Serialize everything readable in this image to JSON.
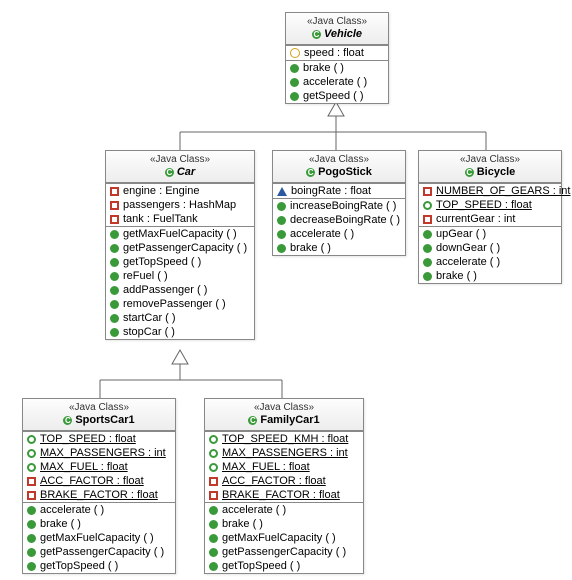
{
  "stereotype": "«Java Class»",
  "classes": {
    "vehicle": {
      "name": "Vehicle",
      "italic": true,
      "attrs": [
        {
          "marker": "diamond",
          "text": "speed : float"
        }
      ],
      "ops": [
        {
          "marker": "green-dot",
          "text": "brake ( )"
        },
        {
          "marker": "green-dot",
          "text": "accelerate ( )"
        },
        {
          "marker": "green-dot",
          "text": "getSpeed ( )"
        }
      ]
    },
    "car": {
      "name": "Car",
      "italic": true,
      "attrs": [
        {
          "marker": "red-sq",
          "text": "engine : Engine"
        },
        {
          "marker": "red-sq",
          "text": "passengers : HashMap"
        },
        {
          "marker": "red-sq",
          "text": "tank : FuelTank"
        }
      ],
      "ops": [
        {
          "marker": "green-dot",
          "text": "getMaxFuelCapacity ( )"
        },
        {
          "marker": "green-dot",
          "text": "getPassengerCapacity ( )"
        },
        {
          "marker": "green-dot",
          "text": "getTopSpeed ( )"
        },
        {
          "marker": "green-dot",
          "text": "reFuel ( )"
        },
        {
          "marker": "green-dot",
          "text": "addPassenger ( )"
        },
        {
          "marker": "green-dot",
          "text": "removePassenger ( )"
        },
        {
          "marker": "green-dot",
          "text": "startCar ( )"
        },
        {
          "marker": "green-dot",
          "text": "stopCar ( )"
        }
      ]
    },
    "pogo": {
      "name": "PogoStick",
      "italic": false,
      "attrs": [
        {
          "marker": "blue-tri",
          "text": "boingRate : float"
        }
      ],
      "ops": [
        {
          "marker": "green-dot",
          "text": "increaseBoingRate ( )"
        },
        {
          "marker": "green-dot",
          "text": "decreaseBoingRate ( )"
        },
        {
          "marker": "green-dot",
          "text": "accelerate ( )"
        },
        {
          "marker": "green-dot",
          "text": "brake ( )"
        }
      ]
    },
    "bicycle": {
      "name": "Bicycle",
      "italic": false,
      "attrs": [
        {
          "marker": "red-sq",
          "text": "NUMBER_OF_GEARS : int",
          "underline": true
        },
        {
          "marker": "green-ring",
          "text": "TOP_SPEED : float",
          "underline": true
        },
        {
          "marker": "red-sq",
          "text": "currentGear : int"
        }
      ],
      "ops": [
        {
          "marker": "green-dot",
          "text": "upGear ( )"
        },
        {
          "marker": "green-dot",
          "text": "downGear ( )"
        },
        {
          "marker": "green-dot",
          "text": "accelerate ( )"
        },
        {
          "marker": "green-dot",
          "text": "brake ( )"
        }
      ]
    },
    "sports": {
      "name": "SportsCar1",
      "italic": false,
      "attrs": [
        {
          "marker": "green-ring",
          "text": "TOP_SPEED : float",
          "underline": true
        },
        {
          "marker": "green-ring",
          "text": "MAX_PASSENGERS : int",
          "underline": true
        },
        {
          "marker": "green-ring",
          "text": "MAX_FUEL : float",
          "underline": true
        },
        {
          "marker": "red-sq",
          "text": "ACC_FACTOR : float",
          "underline": true
        },
        {
          "marker": "red-sq",
          "text": "BRAKE_FACTOR : float",
          "underline": true
        }
      ],
      "ops": [
        {
          "marker": "green-dot",
          "text": "accelerate ( )"
        },
        {
          "marker": "green-dot",
          "text": "brake ( )"
        },
        {
          "marker": "green-dot",
          "text": "getMaxFuelCapacity ( )"
        },
        {
          "marker": "green-dot",
          "text": "getPassengerCapacity ( )"
        },
        {
          "marker": "green-dot",
          "text": "getTopSpeed ( )"
        }
      ]
    },
    "family": {
      "name": "FamilyCar1",
      "italic": false,
      "attrs": [
        {
          "marker": "green-ring",
          "text": "TOP_SPEED_KMH : float",
          "underline": true
        },
        {
          "marker": "green-ring",
          "text": "MAX_PASSENGERS : int",
          "underline": true
        },
        {
          "marker": "green-ring",
          "text": "MAX_FUEL : float",
          "underline": true
        },
        {
          "marker": "red-sq",
          "text": "ACC_FACTOR : float",
          "underline": true
        },
        {
          "marker": "red-sq",
          "text": "BRAKE_FACTOR : float",
          "underline": true
        }
      ],
      "ops": [
        {
          "marker": "green-dot",
          "text": "accelerate ( )"
        },
        {
          "marker": "green-dot",
          "text": "brake ( )"
        },
        {
          "marker": "green-dot",
          "text": "getMaxFuelCapacity ( )"
        },
        {
          "marker": "green-dot",
          "text": "getPassengerCapacity ( )"
        },
        {
          "marker": "green-dot",
          "text": "getTopSpeed ( )"
        }
      ]
    }
  },
  "chart_data": {
    "type": "table",
    "description": "UML class inheritance diagram",
    "inheritance": [
      {
        "child": "Car",
        "parent": "Vehicle"
      },
      {
        "child": "PogoStick",
        "parent": "Vehicle"
      },
      {
        "child": "Bicycle",
        "parent": "Vehicle"
      },
      {
        "child": "SportsCar1",
        "parent": "Car"
      },
      {
        "child": "FamilyCar1",
        "parent": "Car"
      }
    ]
  }
}
